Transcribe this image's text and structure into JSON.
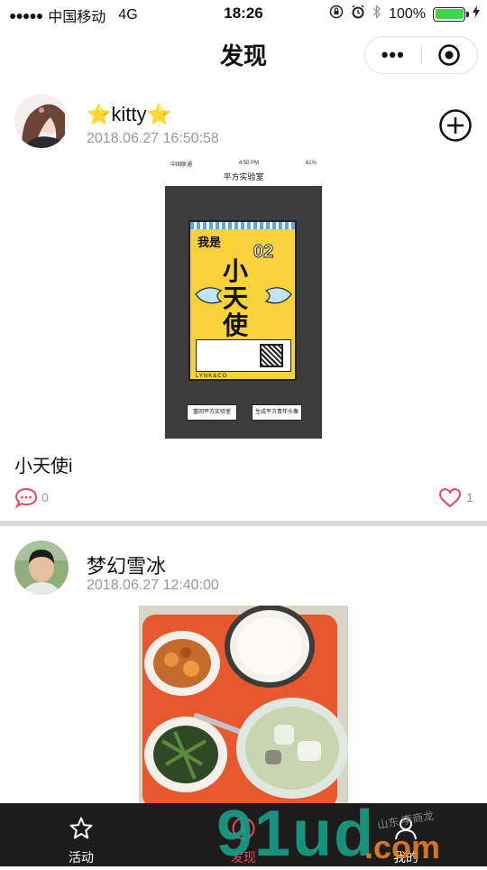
{
  "status_bar": {
    "signal": "●●●●●",
    "carrier": "中国移动",
    "network": "4G",
    "time": "18:26",
    "battery_percent": "100%"
  },
  "nav": {
    "title": "发现",
    "more_label": "•••"
  },
  "posts": [
    {
      "username": "⭐kitty⭐",
      "date": "2018.06.27 16:50:58",
      "image": {
        "carrier": "中国联通",
        "time": "4:50 PM",
        "battery": "61%",
        "title": "平方实验室",
        "poster_me": "我是",
        "poster_big": "小天使",
        "poster_num": "02",
        "poster_brand": "LYNK&CO",
        "button_left": "重回平方实验室",
        "button_right": "生成平方青年头像"
      },
      "caption": "小天使i",
      "comments": "0",
      "likes": "1"
    },
    {
      "username": "梦幻雪冰",
      "date": "2018.06.27 12:40:00"
    }
  ],
  "tabs": [
    {
      "label": "活动",
      "icon": "star-icon"
    },
    {
      "label": "发现",
      "icon": "discover-icon"
    },
    {
      "label": "我的",
      "icon": "user-icon"
    }
  ],
  "watermark": {
    "main": "91ud",
    "suffix": ".com",
    "small": "山东 李商龙"
  },
  "colors": {
    "accent": "#e6475b",
    "tabbar": "#1c1c1c",
    "battery": "#3fd34a"
  }
}
